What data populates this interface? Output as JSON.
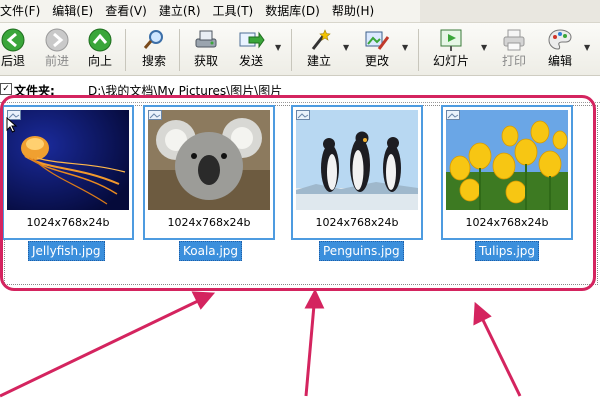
{
  "menubar": {
    "items": [
      {
        "label": "文件(F)"
      },
      {
        "label": "编辑(E)"
      },
      {
        "label": "查看(V)"
      },
      {
        "label": "建立(R)"
      },
      {
        "label": "工具(T)"
      },
      {
        "label": "数据库(D)"
      },
      {
        "label": "帮助(H)"
      }
    ]
  },
  "toolbar": {
    "back": "后退",
    "forward": "前进",
    "up": "向上",
    "search": "搜索",
    "acquire": "获取",
    "send": "发送",
    "create": "建立",
    "modify": "更改",
    "slideshow": "幻灯片",
    "print": "打印",
    "edit": "编辑"
  },
  "address": {
    "label": "文件夹:",
    "path": "D:\\我的文档\\My Pictures\\图片\\图片"
  },
  "thumbnails": [
    {
      "name": "Jellyfish.jpg",
      "dimensions": "1024x768x24b"
    },
    {
      "name": "Koala.jpg",
      "dimensions": "1024x768x24b"
    },
    {
      "name": "Penguins.jpg",
      "dimensions": "1024x768x24b"
    },
    {
      "name": "Tulips.jpg",
      "dimensions": "1024x768x24b"
    }
  ],
  "colors": {
    "highlight": "#d4245f",
    "selection": "#3b8fdc",
    "selection_border": "#4d9be0"
  },
  "icons": {
    "back": "green-circle-left-arrow-icon",
    "forward": "gray-circle-right-arrow-icon",
    "up": "green-circle-up-arrow-icon",
    "search": "magnifier-icon",
    "acquire": "scanner-icon",
    "send": "send-arrow-icon",
    "create": "magic-wand-icon",
    "modify": "paint-edit-icon",
    "slideshow": "slideshow-icon",
    "print": "printer-icon",
    "edit": "palette-icon"
  }
}
